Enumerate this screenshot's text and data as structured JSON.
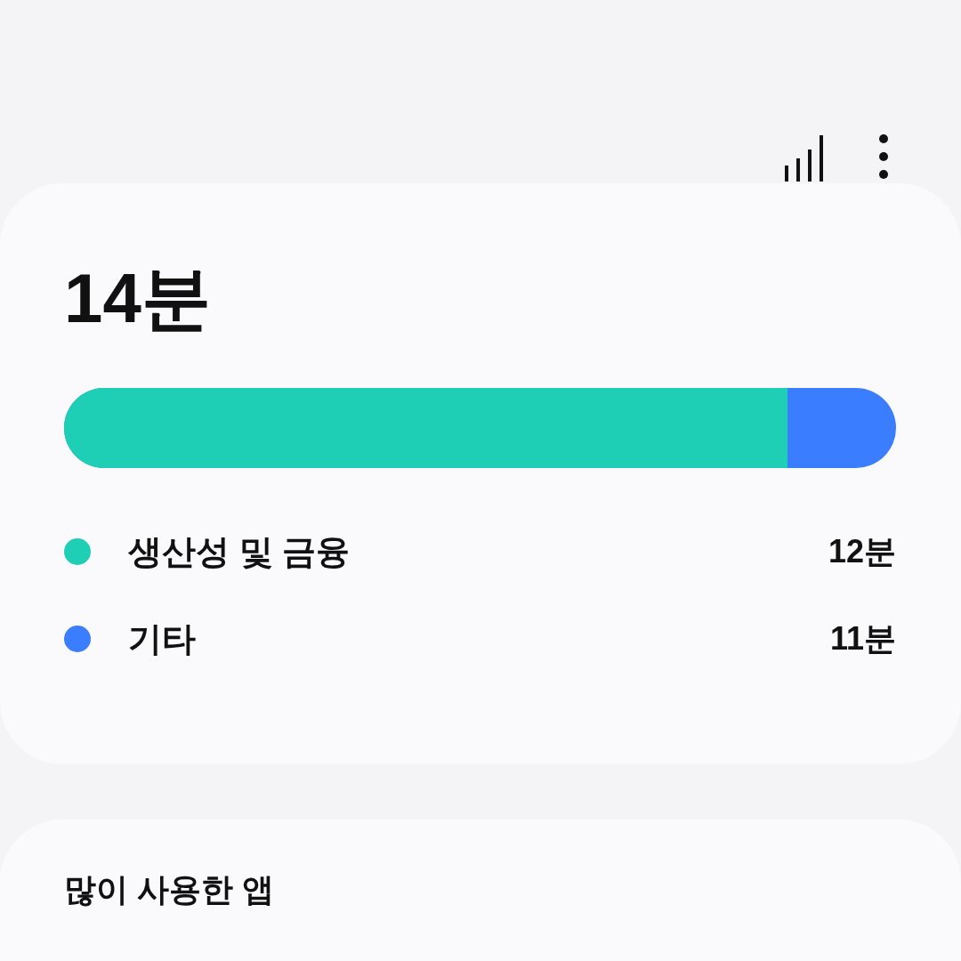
{
  "summary": {
    "total": "14분",
    "level": 0.87,
    "categories": [
      {
        "name": "생산성 및 금융",
        "time": "12분",
        "color": "#1ecfb6"
      },
      {
        "name": "기타",
        "time": "11분",
        "color": "#3b7dff"
      }
    ]
  },
  "top_apps": {
    "title": "많이 사용한 앱"
  }
}
